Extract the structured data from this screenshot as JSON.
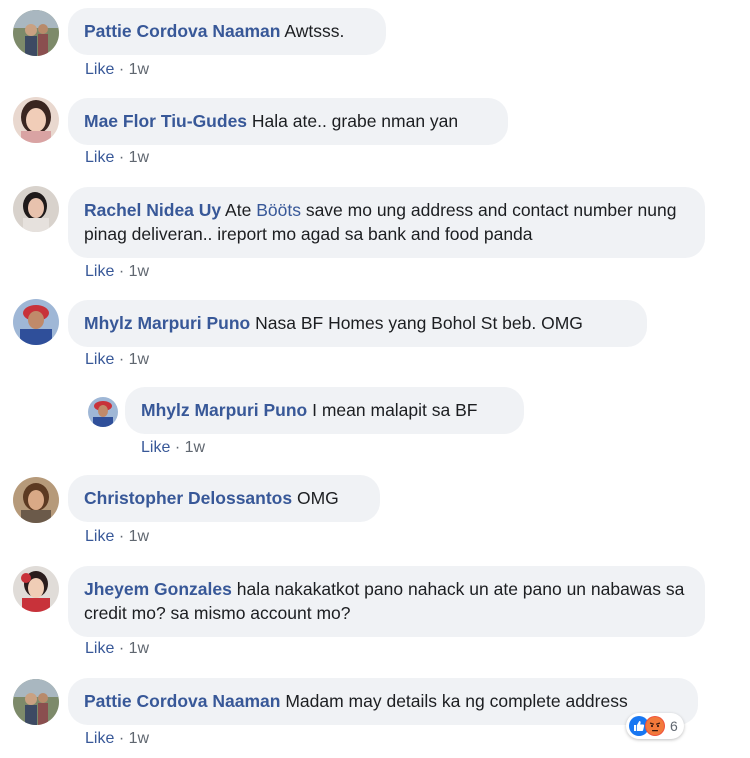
{
  "comments": [
    {
      "name": "Pattie Cordova Naaman",
      "text": "Awtsss.",
      "like": "Like",
      "dot": "·",
      "time": "1w"
    },
    {
      "name": "Mae Flor Tiu-Gudes",
      "text": "Hala ate.. grabe nman yan",
      "like": "Like",
      "dot": "·",
      "time": "1w"
    },
    {
      "name": "Rachel Nidea Uy",
      "text_before": "Ate",
      "mention": "Bööts",
      "text_after": "save mo ung address and contact number nung pinag deliveran.. ireport mo agad sa bank and food panda",
      "like": "Like",
      "dot": "·",
      "time": "1w"
    },
    {
      "name": "Mhylz Marpuri Puno",
      "text": "Nasa BF Homes yang Bohol St beb. OMG",
      "like": "Like",
      "dot": "·",
      "time": "1w"
    },
    {
      "name": "Mhylz Marpuri Puno",
      "text": "I mean malapit sa BF",
      "like": "Like",
      "dot": "·",
      "time": "1w"
    },
    {
      "name": "Christopher Delossantos",
      "text": "OMG",
      "like": "Like",
      "dot": "·",
      "time": "1w"
    },
    {
      "name": "Jheyem Gonzales",
      "text": "hala nakakatkot pano nahack un ate pano un nabawas sa credit mo? sa mismo account mo?",
      "like": "Like",
      "dot": "·",
      "time": "1w"
    },
    {
      "name": "Pattie Cordova Naaman",
      "text": "Madam may details ka ng complete address",
      "like": "Like",
      "dot": "·",
      "time": "1w",
      "reaction_count": "6"
    }
  ],
  "colors": {
    "name": "#385898",
    "bubble": "#f0f2f5",
    "meta": "#606770",
    "like_reaction": "#1877f2",
    "angry_reaction": "#f0513b"
  }
}
